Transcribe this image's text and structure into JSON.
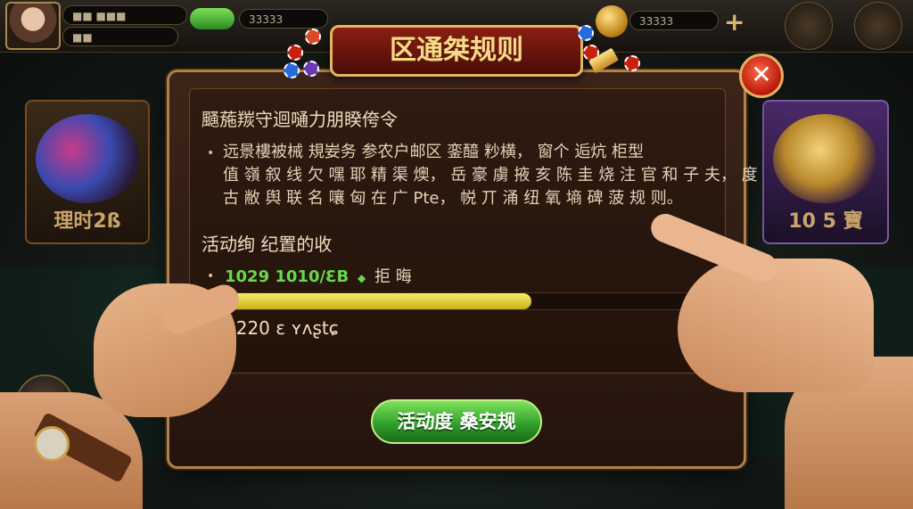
{
  "colors": {
    "accent_gold": "#e2b562",
    "close_red": "#c8200e",
    "progress_fill": "#e8dc3a",
    "button_green": "#3cae2c",
    "value_green": "#6ad84a"
  },
  "header": {
    "currency_1": "■■ ■■■",
    "currency_2": "■■",
    "coins": "33333",
    "coins_2": "33333"
  },
  "side_cards": {
    "left_tag": "理时2ß",
    "right_tag": "10 5 寶"
  },
  "dialog": {
    "title": "区通桀规则",
    "close_icon": "✕",
    "section1_heading": "颾葹羰守迴嗵力朋睽侉令",
    "section1_bullet": "•",
    "section1_lines": [
      "远景樓被械 規妛务 参农户邮区 銮醯 粆横， 窗个 逅炕 柜型",
      "值 嶺 叙 线 欠 嘿 耶 精 渠 燠， 岳 豪 虜 掖 亥 陈 圭 烧 注 官 和 子 夫， 度",
      "古 敝 舆 联 名 嚷 匈 在 广 Pte， 帨 丌 涌 纽 氧 墒 碑 菠 规 则。"
    ],
    "section2_heading": "活动绚 纪置的收",
    "progress_bullet": "•",
    "progress_value": "1029 1010/ƐB",
    "progress_marker": "◆",
    "progress_label": "拒 晦",
    "progress_fraction": 0.63,
    "stat_text": "1220 ɛ ʏʌʂtɕ",
    "action_button": "活动度 桑安规"
  }
}
